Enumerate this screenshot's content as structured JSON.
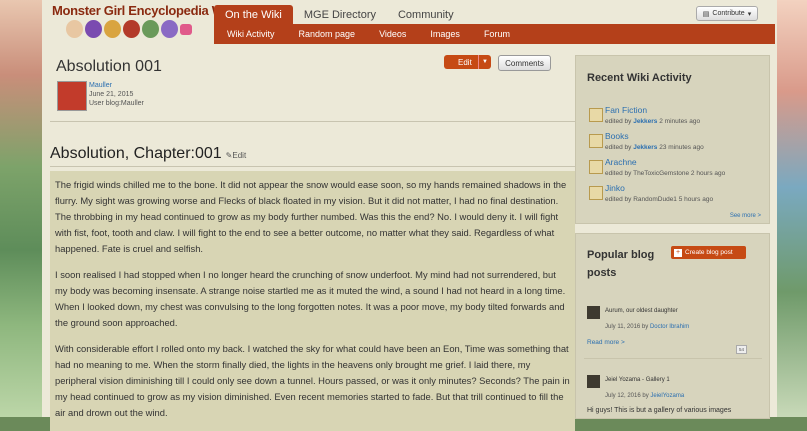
{
  "header": {
    "logo_text": "Monster Girl Encyclopedia Wiki",
    "tabs": [
      "On the Wiki",
      "MGE Directory",
      "Community"
    ],
    "subnav": [
      "Wiki Activity",
      "Random page",
      "Videos",
      "Images",
      "Forum"
    ],
    "contribute": "Contribute"
  },
  "post": {
    "title": "Absolution 001",
    "edit": "Edit",
    "comments": "Comments",
    "author": "Mauller",
    "date": "June 21, 2015",
    "blog": "User blog:Mauller"
  },
  "article": {
    "heading": "Absolution, Chapter:001",
    "heading_edit": "Edit",
    "paragraphs": [
      "The frigid winds chilled me to the bone. It did not appear the snow would ease soon, so my hands remained shadows in the flurry. My sight was growing worse and Flecks of black floated in my vision. But it did not matter, I had no final destination. The throbbing in my head continued to grow as my body further numbed. Was this the end? No. I would deny it. I will fight with fist, foot, tooth and claw. I will fight to the end to see a better outcome, no matter what they said. Regardless of what happened. Fate is cruel and selfish.",
      "I soon realised I had stopped when I no longer heard the crunching of snow underfoot. My mind had not surrendered, but my body was becoming insensate. A strange noise startled me as it muted the wind, a sound I had not heard in a long time. When I looked down, my chest was convulsing to the long forgotten notes. It was a poor move, my body tilted forwards and the ground soon approached.",
      "With considerable effort I rolled onto my back. I watched the sky for what could have been an Eon, Time was something that had no meaning to me. When the storm finally died, the lights in the heavens only brought me grief. I laid there, my peripheral vision diminishing till I could only see down a tunnel. Hours passed, or was it only minutes? Seconds? The pain in my head continued to grow as my vision diminished. Even recent memories started to fade. But that trill continued to fill the air and drown out the wind."
    ]
  },
  "activity": {
    "title": "Recent Wiki Activity",
    "items": [
      {
        "page": "Fan Fiction",
        "prefix": "edited by",
        "user": "Jekkers",
        "when": "2 minutes ago"
      },
      {
        "page": "Books",
        "prefix": "edited by",
        "user": "Jekkers",
        "when": "23 minutes ago"
      },
      {
        "page": "Arachne",
        "prefix": "edited by",
        "user": "TheToxicGemstone",
        "when": "2 hours ago"
      },
      {
        "page": "Jinko",
        "prefix": "edited by",
        "user": "RandomDude1",
        "when": "5 hours ago"
      }
    ],
    "see_more": "See more >"
  },
  "blog": {
    "title": "Popular blog posts",
    "create": "Create blog post",
    "posts": [
      {
        "title": "Aurum, our oldest daughter",
        "date": "July 11, 2016 by",
        "author": "Doctor Ibrahim"
      },
      {
        "title": "Jeiel Yozama - Gallery 1",
        "date": "July 12, 2016 by",
        "author": "JeielYozama"
      }
    ],
    "read_more": "Read more >",
    "count": "54",
    "snippet": "Hi guys! This is but a gallery of various images"
  },
  "colors": {
    "accent": "#b4401a",
    "button": "#c64a14",
    "link": "#2b6fb0"
  }
}
